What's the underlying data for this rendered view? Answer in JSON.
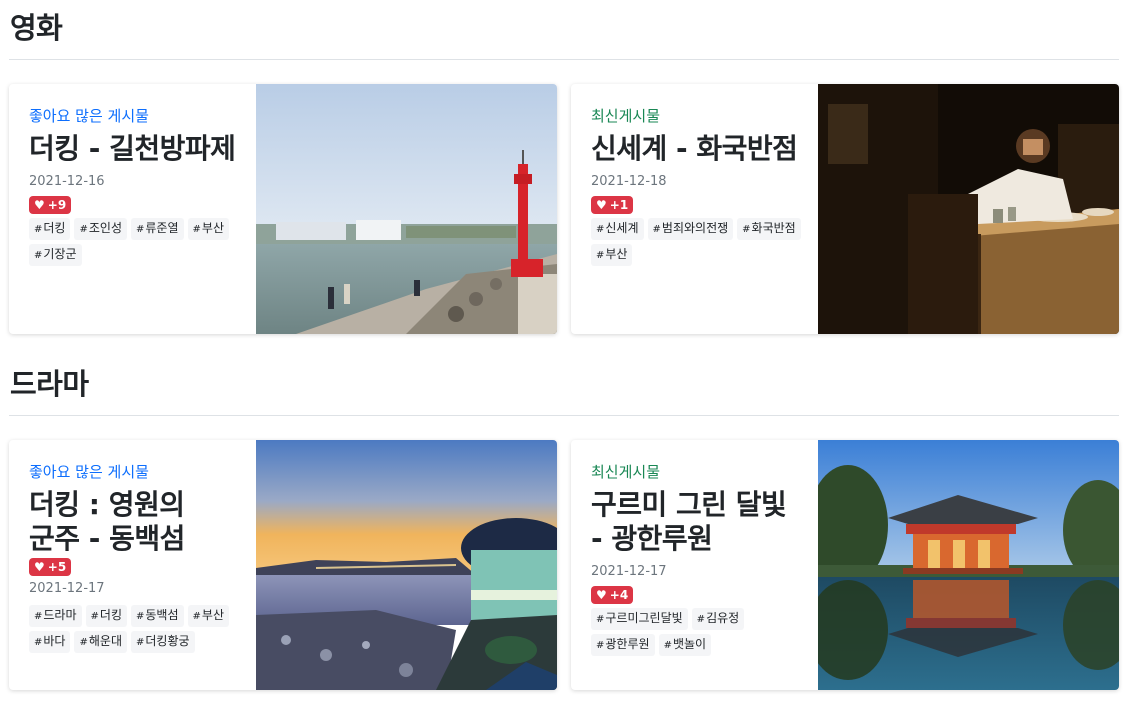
{
  "sections": [
    {
      "title": "영화",
      "cards": [
        {
          "category": "좋아요 많은 게시물",
          "category_type": "popular",
          "title": "더킹 - 길천방파제",
          "date": "2021-12-16",
          "likes": "+9",
          "tags": [
            "더킹",
            "조인성",
            "류준열",
            "부산",
            "기장군"
          ],
          "image": "breakwater-lighthouse-photo"
        },
        {
          "category": "최신게시물",
          "category_type": "latest",
          "title": "신세계 - 화국반점",
          "date": "2021-12-18",
          "likes": "+1",
          "tags": [
            "신세계",
            "범죄와의전쟁",
            "화국반점",
            "부산"
          ],
          "image": "restaurant-scene-photo"
        }
      ]
    },
    {
      "title": "드라마",
      "cards": [
        {
          "category": "좋아요 많은 게시물",
          "category_type": "popular",
          "title": "더킹 : 영원의 군주 - 동백섬",
          "date": "2021-12-17",
          "likes": "+5",
          "tags": [
            "드라마",
            "더킹",
            "동백섬",
            "부산",
            "바다",
            "해운대",
            "더킹황궁"
          ],
          "image": "dongbaek-island-sunset-photo"
        },
        {
          "category": "최신게시물",
          "category_type": "latest",
          "title": "구르미 그린 달빛 - 광한루원",
          "date": "2021-12-17",
          "likes": "+4",
          "tags": [
            "구르미그린달빛",
            "김유정",
            "광한루원",
            "뱃놀이"
          ],
          "image": "pavilion-reflection-photo"
        }
      ]
    }
  ],
  "colors": {
    "popular": "#0d6efd",
    "latest": "#198754",
    "like_badge": "#dc3545",
    "divider": "#dee2e6"
  },
  "icons": {
    "like": "heart-icon",
    "tag": "hash-icon"
  }
}
